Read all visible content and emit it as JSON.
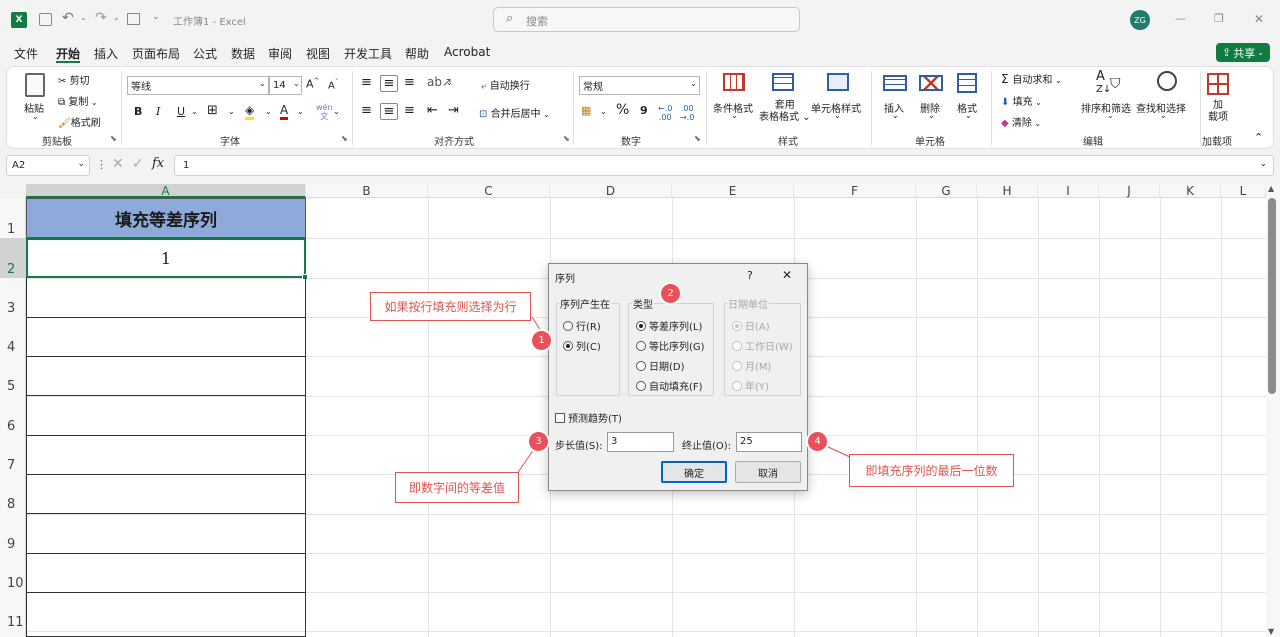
{
  "title_bar": {
    "app_icon": "excel-icon",
    "window_title": "工作簿1 - Excel",
    "search_placeholder": "搜索",
    "user_initials": "ZG",
    "minimize": "—",
    "restore": "❐",
    "close": "✕"
  },
  "menu": {
    "items": [
      "文件",
      "开始",
      "插入",
      "页面布局",
      "公式",
      "数据",
      "审阅",
      "视图",
      "开发工具",
      "帮助",
      "Acrobat"
    ],
    "active": "开始",
    "share_label": "共享"
  },
  "ribbon": {
    "clipboard": {
      "paste": "粘贴",
      "cut": "剪切",
      "copy": "复制",
      "format_painter": "格式刷",
      "group": "剪贴板"
    },
    "font": {
      "name": "等线",
      "size": "14",
      "bold": "B",
      "italic": "I",
      "underline": "U",
      "group": "字体"
    },
    "alignment": {
      "wrap": "自动换行",
      "merge": "合并后居中",
      "group": "对齐方式"
    },
    "number": {
      "format": "常规",
      "percent": "%",
      "comma": "9",
      "group": "数字"
    },
    "styles": {
      "conditional": "条件格式",
      "table_line1": "套用",
      "table_line2": "表格格式",
      "cell_styles": "单元格样式",
      "group": "样式"
    },
    "cells": {
      "insert": "插入",
      "delete": "删除",
      "format": "格式",
      "group": "单元格"
    },
    "editing": {
      "autosum": "自动求和",
      "fill": "填充",
      "clear": "清除",
      "sort": "排序和筛选",
      "find": "查找和选择",
      "group": "编辑"
    },
    "addins": {
      "label_line1": "加",
      "label_line2": "载项",
      "group": "加载项"
    }
  },
  "formula_bar": {
    "name_box": "A2",
    "fx": "fx",
    "value": "1"
  },
  "grid": {
    "columns": [
      "A",
      "B",
      "C",
      "D",
      "E",
      "F",
      "G",
      "H",
      "I",
      "J",
      "K",
      "L"
    ],
    "rows": [
      "1",
      "2",
      "3",
      "4",
      "5",
      "6",
      "7",
      "8",
      "9",
      "10",
      "11"
    ],
    "a1": "填充等差序列",
    "a2": "1",
    "header_fill": "#8eaadb"
  },
  "dialog": {
    "title": "序列",
    "help": "?",
    "close": "✕",
    "series_in": {
      "label": "序列产生在",
      "rows": "行(R)",
      "columns": "列(C)",
      "selected": "columns"
    },
    "type": {
      "label": "类型",
      "linear": "等差序列(L)",
      "growth": "等比序列(G)",
      "date": "日期(D)",
      "autofill": "自动填充(F)",
      "selected": "linear"
    },
    "date_unit": {
      "label": "日期单位",
      "day": "日(A)",
      "weekday": "工作日(W)",
      "month": "月(M)",
      "year": "年(Y)"
    },
    "trend": "预测趋势(T)",
    "step_label": "步长值(S):",
    "step_value": "3",
    "stop_label": "终止值(O):",
    "stop_value": "25",
    "ok": "确定",
    "cancel": "取消"
  },
  "annotations": {
    "c1": "如果按行填充则选择为行",
    "c3": "即数字间的等差值",
    "c4": "即填充序列的最后一位数",
    "b1": "1",
    "b2": "2",
    "b3": "3",
    "b4": "4",
    "accent": "#e0544f"
  }
}
